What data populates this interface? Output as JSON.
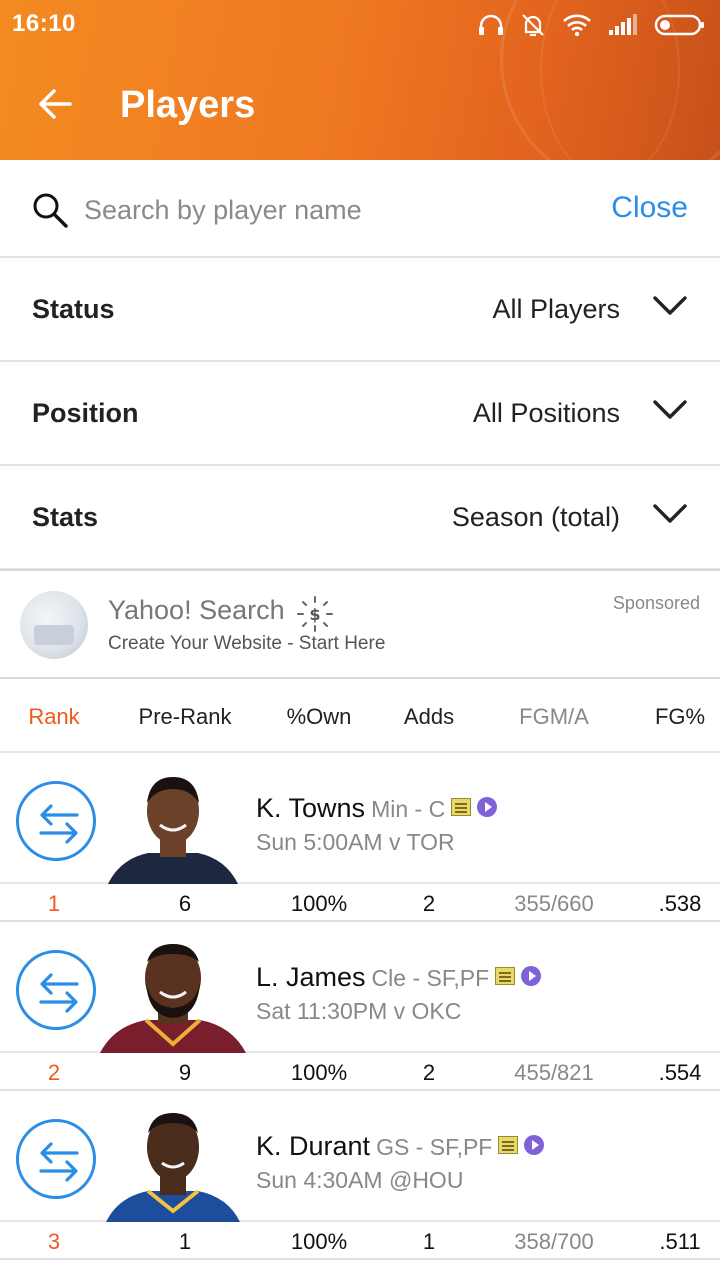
{
  "status_bar": {
    "time": "16:10"
  },
  "header": {
    "title": "Players"
  },
  "search": {
    "placeholder": "Search by player name",
    "value": "",
    "close_label": "Close"
  },
  "filters": [
    {
      "label": "Status",
      "value": "All Players"
    },
    {
      "label": "Position",
      "value": "All Positions"
    },
    {
      "label": "Stats",
      "value": "Season (total)"
    }
  ],
  "ad": {
    "title": "Yahoo! Search",
    "subtitle": "Create Your Website - Start Here",
    "tag": "Sponsored"
  },
  "columns": [
    "Rank",
    "Pre-Rank",
    "%Own",
    "Adds",
    "FGM/A",
    "FG%"
  ],
  "players": [
    {
      "name": "K. Towns",
      "team_pos": "Min - C",
      "game": "Sun 5:00AM v TOR",
      "rank": "1",
      "pre_rank": "6",
      "own": "100%",
      "adds": "2",
      "fgma": "355/660",
      "fg": ".538",
      "jersey": "#1d2740",
      "skin": "#6b4229"
    },
    {
      "name": "L. James",
      "team_pos": "Cle - SF,PF",
      "game": "Sat 11:30PM v OKC",
      "rank": "2",
      "pre_rank": "9",
      "own": "100%",
      "adds": "2",
      "fgma": "455/821",
      "fg": ".554",
      "jersey": "#7a1e2e",
      "skin": "#5a3320"
    },
    {
      "name": "K. Durant",
      "team_pos": "GS - SF,PF",
      "game": "Sun 4:30AM @HOU",
      "rank": "3",
      "pre_rank": "1",
      "own": "100%",
      "adds": "1",
      "fgma": "358/700",
      "fg": ".511",
      "jersey": "#1d4e9e",
      "skin": "#4a2c1c"
    }
  ]
}
